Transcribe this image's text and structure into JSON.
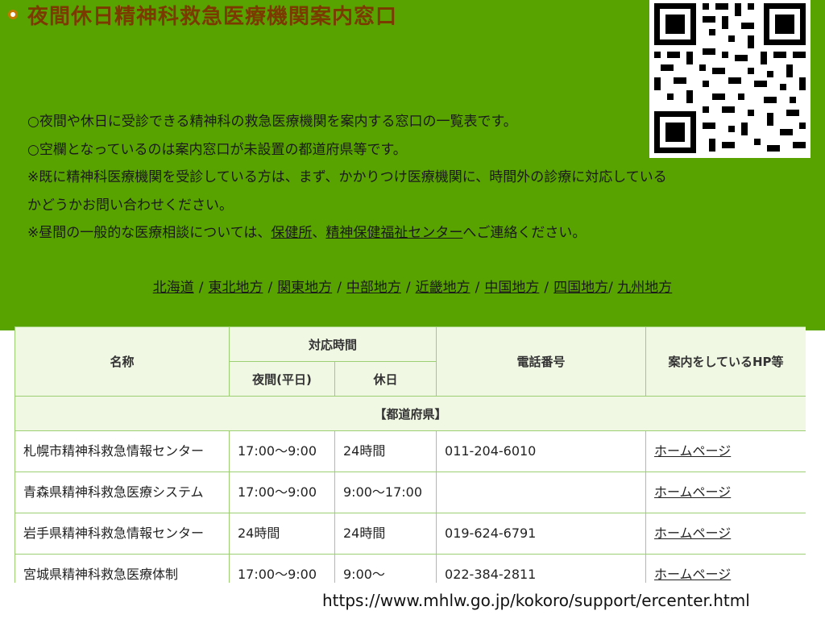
{
  "page": {
    "title": "夜間休日精神科救急医療機関案内窓口",
    "notes": {
      "line1": "○夜間や休日に受診できる精神科の救急医療機関を案内する窓口の一覧表です。",
      "line2": "○空欄となっているのは案内窓口が未設置の都道府県等です。",
      "line3": "※既に精神科医療機関を受診している方は、まず、かかりつけ医療機関に、時間外の診療に対応している",
      "line4": "かどうかお問い合わせください。",
      "line5_pre": "※昼間の一般的な医療相談については、",
      "link_hokenjo": "保健所",
      "line5_mid": "、",
      "link_center": "精神保健福祉センター",
      "line5_post": "へご連絡ください。"
    },
    "regions": [
      "北海道",
      "東北地方",
      "関東地方",
      "中部地方",
      "近畿地方",
      "中国地方",
      "四国地方",
      "九州地方"
    ]
  },
  "table": {
    "headers": {
      "name": "名称",
      "hours": "対応時間",
      "night": "夜間(平日)",
      "holiday": "休日",
      "phone": "電話番号",
      "hp": "案内をしているHP等"
    },
    "section": "【都道府県】",
    "rows": [
      {
        "name": "札幌市精神科救急情報センター",
        "night": "17:00～9:00",
        "holiday": "24時間",
        "phone": "011-204-6010",
        "hp": "ホームページ"
      },
      {
        "name": "青森県精神科救急医療システム",
        "night": "17:00～9:00",
        "holiday": "9:00～17:00",
        "phone": "",
        "hp": "ホームページ"
      },
      {
        "name": "岩手県精神科救急情報センター",
        "night": "24時間",
        "holiday": "24時間",
        "phone": "019-624-6791",
        "hp": "ホームページ"
      },
      {
        "name": "宮城県精神科救急医療体制",
        "night": "17:00～9:00",
        "holiday": "9:00～",
        "phone": "022-384-2811",
        "hp": "ホームページ"
      }
    ]
  },
  "footer": {
    "url": "https://www.mhlw.go.jp/kokoro/support/ercenter.html"
  }
}
